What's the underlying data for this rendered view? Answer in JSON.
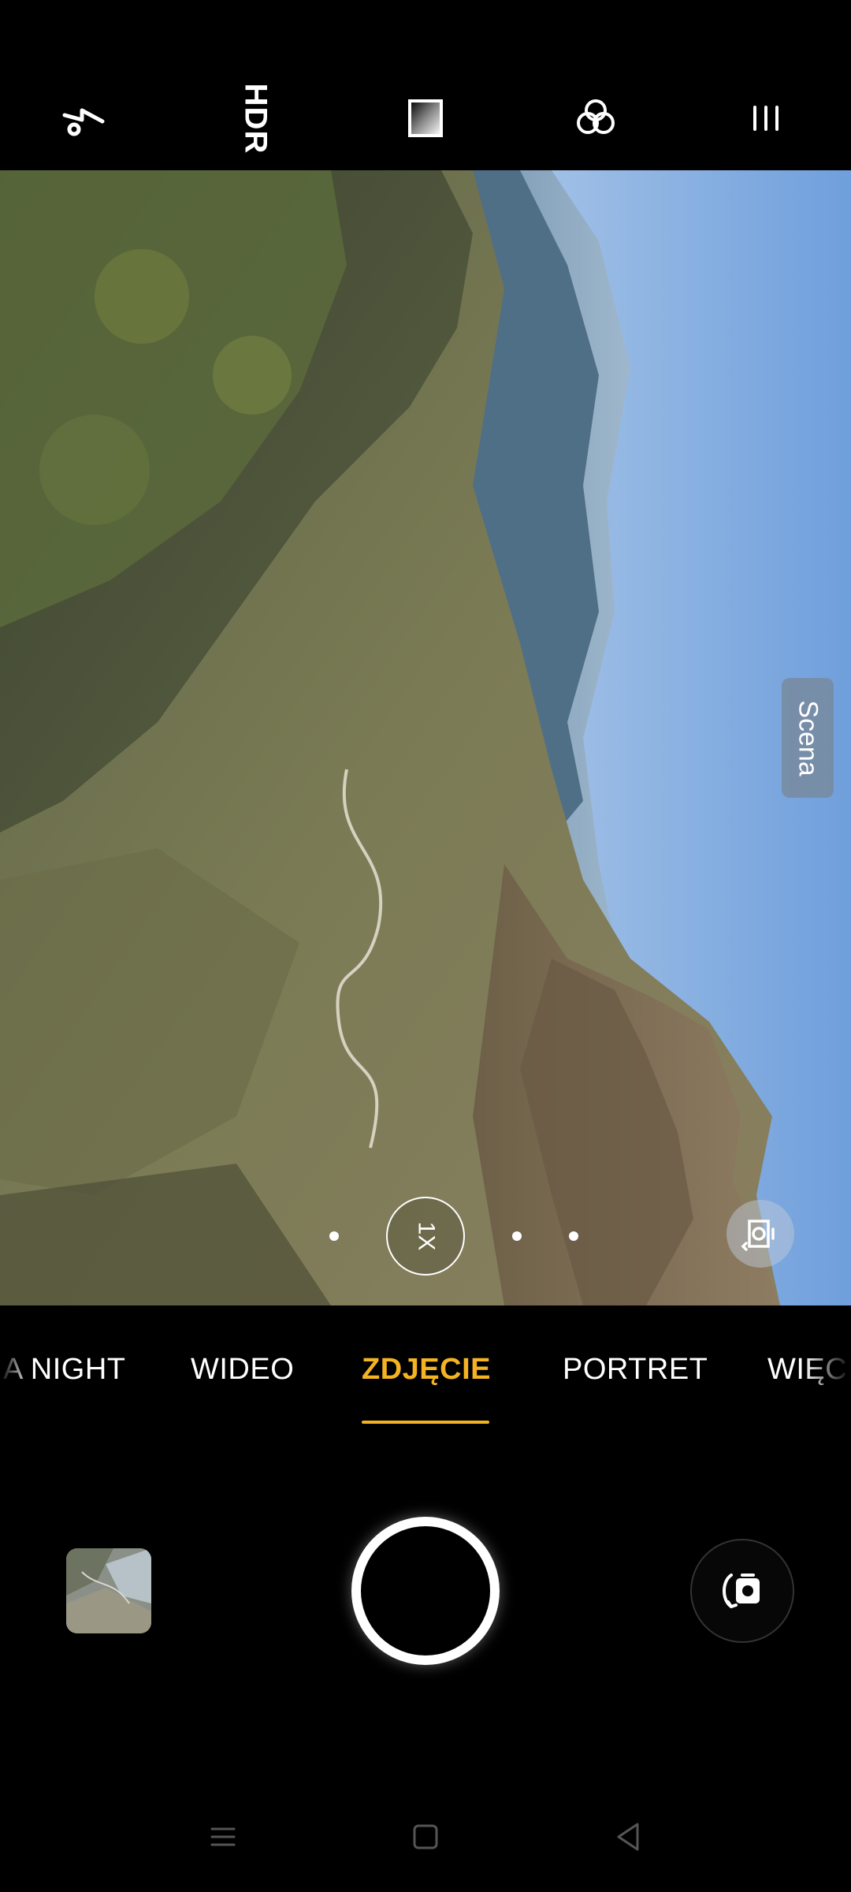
{
  "toolbar": {
    "flash_icon": "flash-off-icon",
    "hdr_label": "HDR",
    "filter_icon": "filter-gradient-icon",
    "color_icon": "color-circles-icon",
    "menu_icon": "menu-bars-icon"
  },
  "viewfinder": {
    "scene_label": "Scena",
    "zoom_label": "1X",
    "lens_icon": "lens-switch-icon"
  },
  "modes": {
    "items": [
      "A NIGHT",
      "WIDEO",
      "ZDJĘCIE",
      "PORTRET",
      "WIĘCE"
    ],
    "active": "ZDJĘCIE",
    "active_color": "#f3b322"
  },
  "capture": {
    "thumbnail_icon": "gallery-thumbnail",
    "shutter_icon": "shutter-button",
    "flip_icon": "camera-flip-icon"
  },
  "navbar": {
    "items": [
      "menu-icon",
      "home-icon",
      "back-icon"
    ]
  }
}
